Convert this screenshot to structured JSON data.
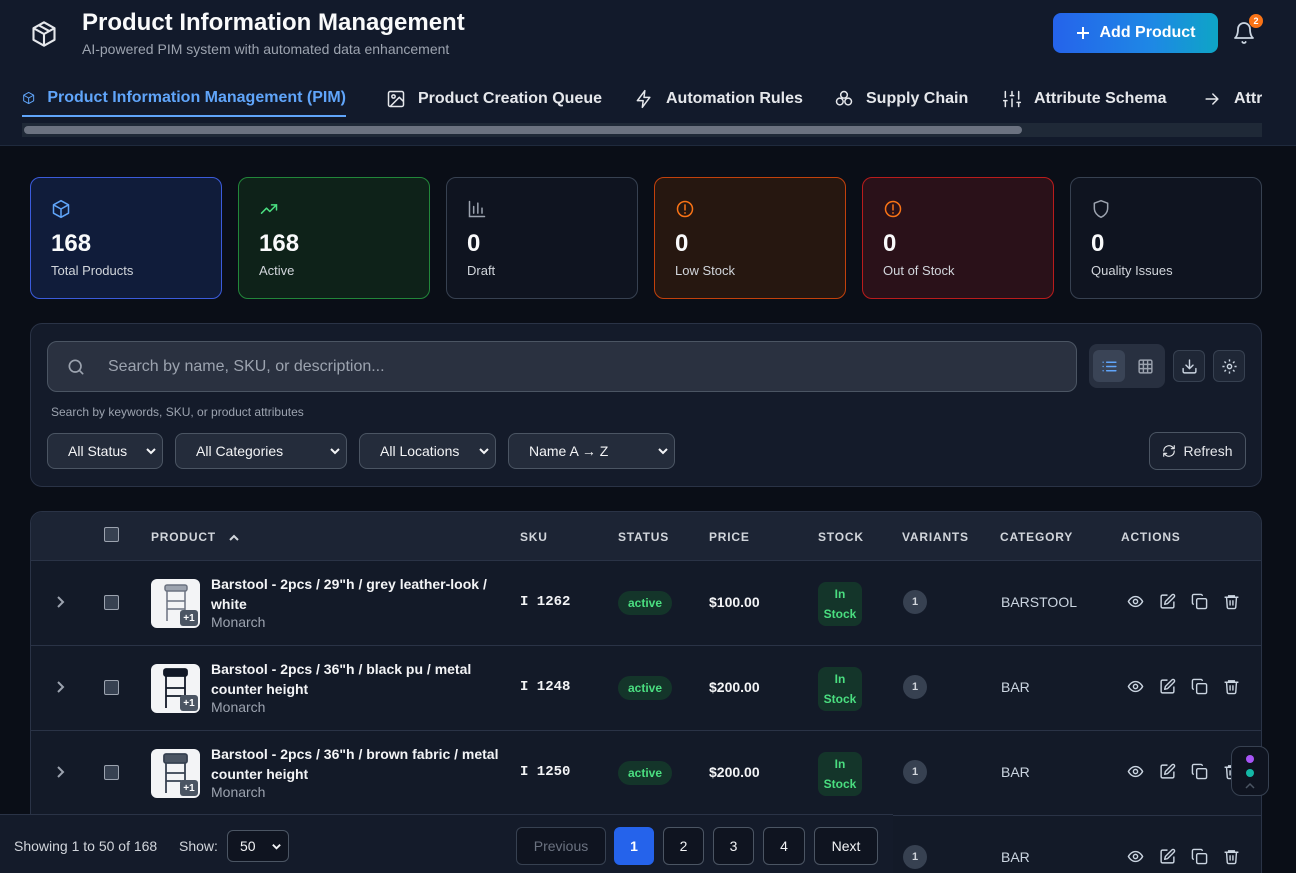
{
  "header": {
    "title": "Product Information Management",
    "subtitle": "AI-powered PIM system with automated data enhancement",
    "add_button": "Add Product",
    "notification_count": "2"
  },
  "tabs": [
    {
      "label": "Product Information Management (PIM)",
      "icon": "cube-icon",
      "active": true
    },
    {
      "label": "Product Creation Queue",
      "icon": "image-icon"
    },
    {
      "label": "Automation Rules",
      "icon": "lightning-icon"
    },
    {
      "label": "Supply Chain",
      "icon": "boxes-icon"
    },
    {
      "label": "Attribute Schema",
      "icon": "sliders-icon"
    },
    {
      "label": "Attri",
      "icon": "arrow-right-icon"
    }
  ],
  "stats": [
    {
      "value": "168",
      "label": "Total Products",
      "icon": "cube-icon",
      "color": "#60a5fa"
    },
    {
      "value": "168",
      "label": "Active",
      "icon": "trending-up-icon",
      "color": "#4ade80"
    },
    {
      "value": "0",
      "label": "Draft",
      "icon": "bar-chart-icon",
      "color": "#9ca3af"
    },
    {
      "value": "0",
      "label": "Low Stock",
      "icon": "alert-circle-icon",
      "color": "#f97316"
    },
    {
      "value": "0",
      "label": "Out of Stock",
      "icon": "alert-circle-icon",
      "color": "#f97316"
    },
    {
      "value": "0",
      "label": "Quality Issues",
      "icon": "shield-icon",
      "color": "#9ca3af"
    }
  ],
  "search": {
    "placeholder": "Search by name, SKU, or description...",
    "hint": "Search by keywords, SKU, or product attributes"
  },
  "filters": {
    "status": "All Status",
    "category": "All Categories",
    "location": "All Locations",
    "sort": "Name A → Z",
    "refresh": "Refresh"
  },
  "table": {
    "columns": [
      "PRODUCT",
      "SKU",
      "STATUS",
      "PRICE",
      "STOCK",
      "VARIANTS",
      "CATEGORY",
      "ACTIONS"
    ],
    "rows": [
      {
        "name": "Barstool - 2pcs / 29\"h / grey leather-look / white",
        "brand": "Monarch",
        "extra_images": "+1",
        "sku": "I 1262",
        "status": "active",
        "price": "$100.00",
        "stock": "In Stock",
        "variants": "1",
        "category": "BARSTOOL"
      },
      {
        "name": "Barstool - 2pcs / 36\"h / black pu / metal counter height",
        "brand": "Monarch",
        "extra_images": "+1",
        "sku": "I 1248",
        "status": "active",
        "price": "$200.00",
        "stock": "In Stock",
        "variants": "1",
        "category": "BAR"
      },
      {
        "name": "Barstool - 2pcs / 36\"h / brown fabric / metal counter height",
        "brand": "Monarch",
        "extra_images": "+1",
        "sku": "I 1250",
        "status": "active",
        "price": "$200.00",
        "stock": "In Stock",
        "variants": "1",
        "category": "BAR"
      },
      {
        "name": "",
        "brand": "",
        "extra_images": "",
        "sku": "",
        "status": "",
        "price": "",
        "stock": "",
        "variants": "1",
        "category": "BAR"
      }
    ]
  },
  "pagination": {
    "showing": "Showing 1 to 50 of 168",
    "show_label": "Show:",
    "page_size": "50",
    "previous": "Previous",
    "pages": [
      "1",
      "2",
      "3",
      "4"
    ],
    "current": "1",
    "next": "Next"
  }
}
